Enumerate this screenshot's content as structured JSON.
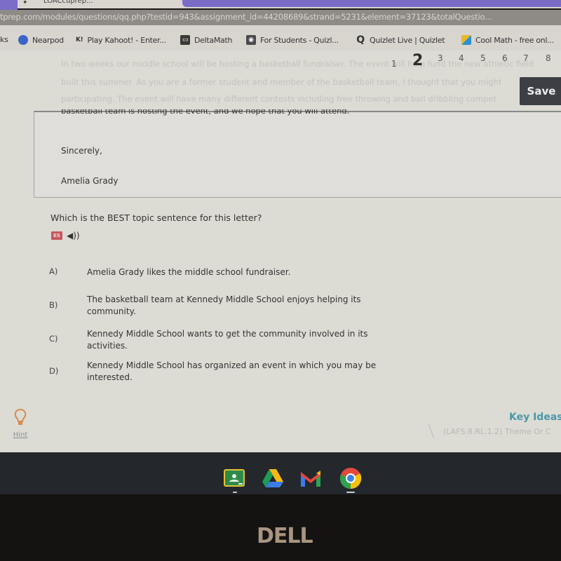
{
  "browser": {
    "tab_title": "LOACcuprep...",
    "url": "tprep.com/modules/questions/qq.php?testid=943&assignment_id=44208689&strand=5231&element=37123&totalQuestio...",
    "bookmarks": [
      {
        "label": "ks",
        "icon": "apps-icon"
      },
      {
        "label": "Nearpod",
        "icon": "nearpod-icon"
      },
      {
        "label": "Play Kahoot! - Enter...",
        "icon": "kahoot-icon"
      },
      {
        "label": "DeltaMath",
        "icon": "deltamath-icon"
      },
      {
        "label": "For Students - Quizl...",
        "icon": "quizizz-icon"
      },
      {
        "label": "Quizlet Live | Quizlet",
        "icon": "quizlet-icon"
      },
      {
        "label": "Cool Math - free onl...",
        "icon": "coolmath-icon"
      }
    ]
  },
  "pager": {
    "pages": [
      "1",
      "2",
      "3",
      "4",
      "5",
      "6",
      "7",
      "8"
    ],
    "current": "2"
  },
  "save_label": "Save",
  "passage": {
    "faded_lines": [
      "In two weeks our middle school will be hosting a basketball fundraiser. The event will help fund the new athletic field",
      "built this summer. As you are a former student and member of the basketball team, I thought that you might",
      "participating. The event will have many different contests including free throwing and ball dribbling compet"
    ],
    "cut_line": "basketball team is hosting the event, and we hope that you will attend.",
    "closing": "Sincerely,",
    "signature": "Amelia Grady"
  },
  "question": {
    "prompt": "Which is the BEST topic sentence for this letter?",
    "translate_icon_text": "ES",
    "choices": [
      {
        "letter": "A)",
        "text": "Amelia Grady likes the middle school fundraiser."
      },
      {
        "letter": "B)",
        "text": "The basketball team at Kennedy Middle School enjoys helping its community."
      },
      {
        "letter": "C)",
        "text": "Kennedy Middle School wants to get the community involved in its activities."
      },
      {
        "letter": "D)",
        "text": "Kennedy Middle School has organized an event in which you may be interested."
      }
    ]
  },
  "hint_label": "Hint",
  "standard": {
    "category": "Key Ideas a",
    "code": "(LAFS.8.RL.1.2) Theme Or C"
  },
  "shelf": {
    "apps": [
      "Google Classroom",
      "Google Drive",
      "Gmail",
      "Chrome"
    ]
  },
  "device_brand": "DELL"
}
